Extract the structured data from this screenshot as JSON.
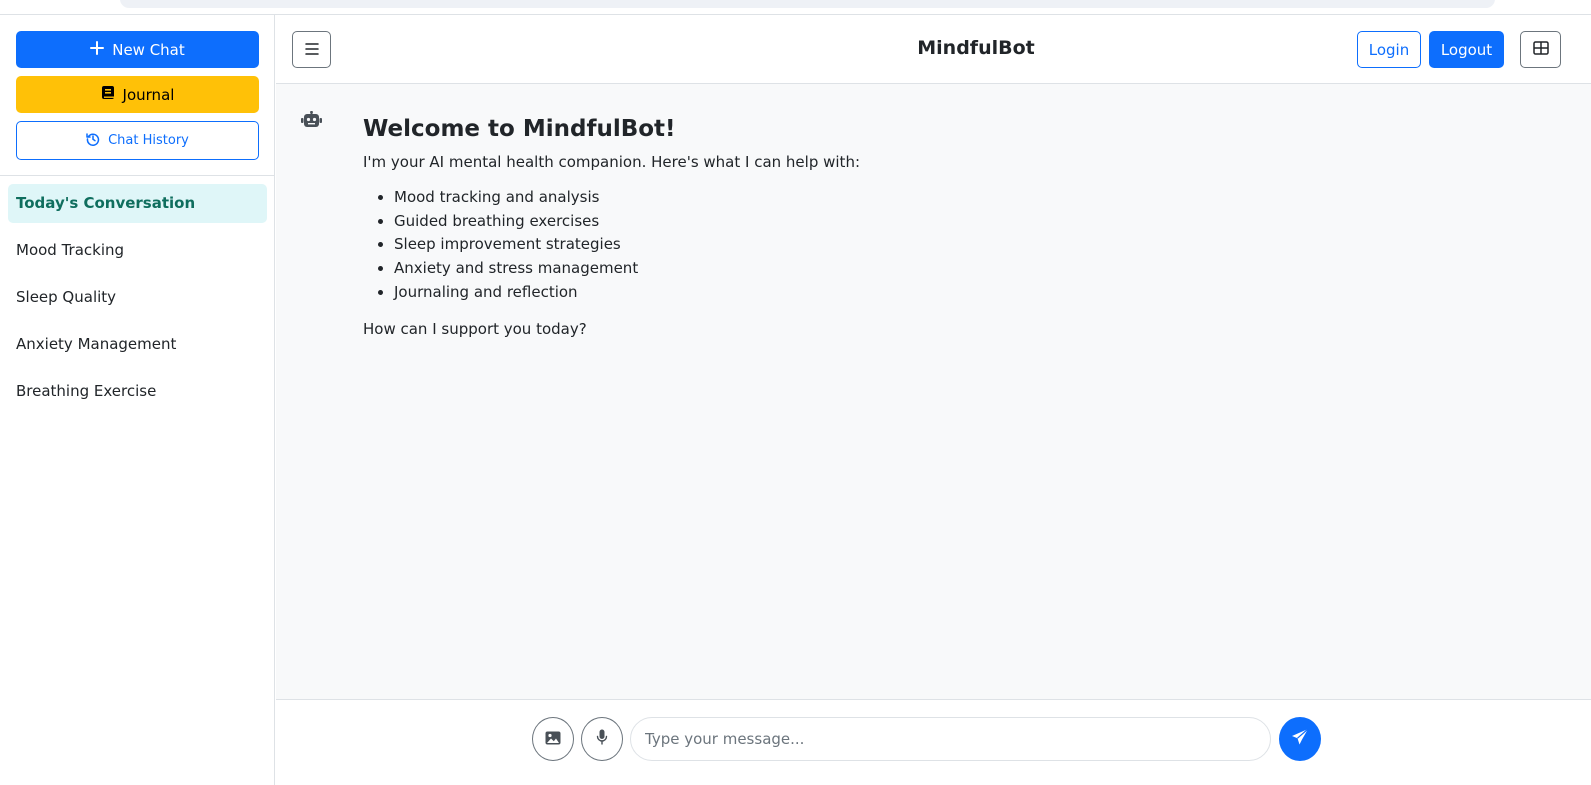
{
  "app": {
    "title": "MindfulBot"
  },
  "sidebar": {
    "new_chat_label": "New Chat",
    "journal_label": "Journal",
    "history_label": "Chat History",
    "conversations": [
      {
        "label": "Today's Conversation",
        "active": true
      },
      {
        "label": "Mood Tracking",
        "active": false
      },
      {
        "label": "Sleep Quality",
        "active": false
      },
      {
        "label": "Anxiety Management",
        "active": false
      },
      {
        "label": "Breathing Exercise",
        "active": false
      }
    ]
  },
  "header": {
    "login_label": "Login",
    "logout_label": "Logout"
  },
  "chat": {
    "welcome_title": "Welcome to MindfulBot!",
    "intro": "I'm your AI mental health companion. Here's what I can help with:",
    "features": [
      "Mood tracking and analysis",
      "Guided breathing exercises",
      "Sleep improvement strategies",
      "Anxiety and stress management",
      "Journaling and reflection"
    ],
    "closing": "How can I support you today?"
  },
  "composer": {
    "placeholder": "Type your message..."
  },
  "icons": {
    "new_chat": "plus-icon",
    "journal": "book-icon",
    "history": "history-icon",
    "menu": "menu-icon",
    "layout": "layout-grid-icon",
    "bot": "robot-icon",
    "image": "image-icon",
    "mic": "microphone-icon",
    "send": "paper-plane-icon"
  },
  "colors": {
    "primary": "#0d6efd",
    "warning": "#ffc107",
    "active_bg": "#dff6f8",
    "active_text": "#0f6e5e"
  }
}
